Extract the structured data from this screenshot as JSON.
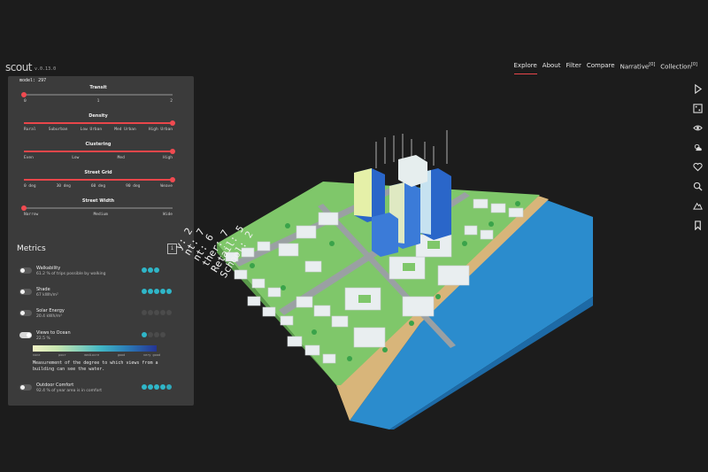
{
  "app": {
    "logo": "scout",
    "version": "v.0.13.0"
  },
  "nav": [
    {
      "label": "Explore",
      "active": true
    },
    {
      "label": "About"
    },
    {
      "label": "Filter"
    },
    {
      "label": "Compare"
    },
    {
      "label": "Narrative",
      "badge": "[0]"
    },
    {
      "label": "Collection",
      "badge": "[0]"
    }
  ],
  "right_icons": [
    "play-icon",
    "dice-icon",
    "eye-icon",
    "cloud-sun-icon",
    "heart-icon",
    "search-icon",
    "mountain-icon",
    "bookmark-icon"
  ],
  "panel": {
    "model": "model: 297",
    "sliders": [
      {
        "title": "Transit",
        "ticks": [
          "0",
          "1",
          "2"
        ],
        "value_fraction": 0.0
      },
      {
        "title": "Density",
        "ticks": [
          "Rural",
          "Suburban",
          "Low Urban",
          "Med Urban",
          "High Urban"
        ],
        "value_fraction": 1.0
      },
      {
        "title": "Clustering",
        "ticks": [
          "Even",
          "Low",
          "Med",
          "High"
        ],
        "value_fraction": 1.0
      },
      {
        "title": "Street Grid",
        "ticks": [
          "0 deg",
          "30 deg",
          "60 deg",
          "90 deg",
          "Weave"
        ],
        "value_fraction": 1.0
      },
      {
        "title": "Street Width",
        "ticks": [
          "Narrow",
          "Medium",
          "Wide"
        ],
        "value_fraction": 0.0
      }
    ],
    "metrics_title": "Metrics",
    "info_label": "i",
    "metrics": [
      {
        "name": "Walkability",
        "desc": "61.2 % of trips possible by walking",
        "score": 3,
        "dots": 3,
        "toggle": false
      },
      {
        "name": "Shade",
        "desc": "67 kWh/m²",
        "score": 5,
        "dots": 5,
        "toggle": false
      },
      {
        "name": "Solar Energy",
        "desc": "20.4 kWh/m²",
        "score": 0,
        "dots": 5,
        "toggle": false
      },
      {
        "name": "Views to Ocean",
        "desc": "22.5 %",
        "score": 1,
        "dots": 4,
        "toggle": true
      },
      {
        "name": "Outdoor Comfort",
        "desc": "92.4 % of year area is in comfort",
        "score": 4.5,
        "dots": 5,
        "toggle": false
      }
    ],
    "legend_labels": [
      "none",
      "poor",
      "mediocre",
      "good",
      "very good"
    ],
    "note": "Measurement of the degree to which views from a building can see the water."
  },
  "overlay_labels": [
    "y: 2",
    "nt: 7",
    "nt: 6",
    "ther: 7",
    "Retail: 5",
    "School: 2"
  ],
  "colors": {
    "accent": "#e8464a",
    "score": "#2fb6c8",
    "water": "#2b8ccd",
    "sand": "#d8b57a",
    "ground": "#7fc76a"
  }
}
